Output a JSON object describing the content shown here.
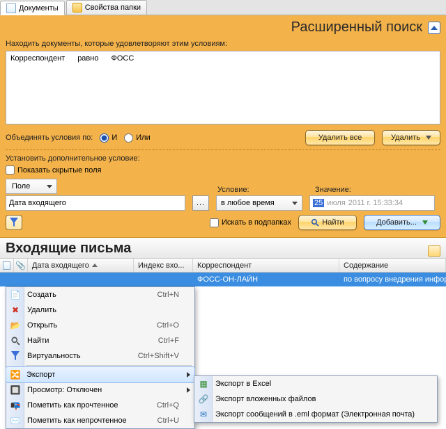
{
  "tabs": {
    "documents": "Документы",
    "folder_props": "Свойства папки"
  },
  "search_panel": {
    "title": "Расширенный поиск",
    "criteria_label": "Находить документы, которые удовлетворяют этим условиям:",
    "criteria": {
      "field": "Корреспондент",
      "op": "равно",
      "value": "ФОСС"
    },
    "combine_label": "Объединять условия по:",
    "radio_and": "И",
    "radio_or": "Или",
    "btn_delete_all": "Удалить все",
    "btn_delete": "Удалить",
    "extra_label": "Установить дополнительное условие:",
    "chk_hidden": "Показать скрытые поля",
    "field_dropdown": "Поле",
    "condition_label": "Условие:",
    "value_label": "Значение:",
    "field_input_value": "Дата входящего",
    "condition_value": "в любое время",
    "date_day": "25",
    "date_month": "июля",
    "date_rest": "2011 г. 15:33:34",
    "chk_subfolders": "Искать в подпапках",
    "btn_find": "Найти",
    "btn_add": "Добавить..."
  },
  "grid": {
    "section_title": "Входящие письма",
    "headers": {
      "date": "Дата входящего",
      "index": "Индекс вхо...",
      "korr": "Корреспондент",
      "content": "Содержание"
    },
    "row": {
      "korr": "ФОСС-ОН-ЛАЙН",
      "content": "по вопросу внедрения информаци"
    }
  },
  "menu": {
    "create": {
      "label": "Создать",
      "shortcut": "Ctrl+N"
    },
    "delete": {
      "label": "Удалить"
    },
    "open": {
      "label": "Открыть",
      "shortcut": "Ctrl+O"
    },
    "find": {
      "label": "Найти",
      "shortcut": "Ctrl+F"
    },
    "virtual": {
      "label": "Виртуальность",
      "shortcut": "Ctrl+Shift+V"
    },
    "export": {
      "label": "Экспорт"
    },
    "preview": {
      "label": "Просмотр: Отключен"
    },
    "mark_read": {
      "label": "Пометить как прочтенное",
      "shortcut": "Ctrl+Q"
    },
    "mark_unread": {
      "label": "Пометить как непрочтенное",
      "shortcut": "Ctrl+U"
    }
  },
  "submenu": {
    "excel": "Экспорт в Excel",
    "attach": "Экспорт вложенных файлов",
    "eml": "Экспорт сообщений в .eml формат (Электронная почта)"
  }
}
